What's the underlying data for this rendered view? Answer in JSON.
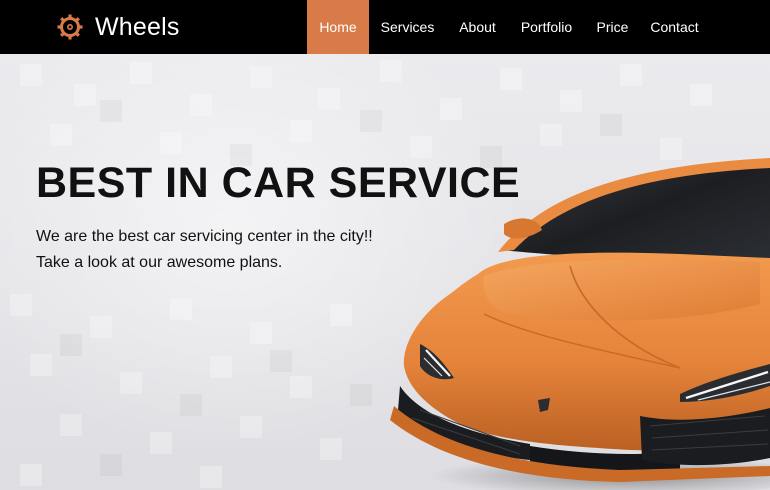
{
  "brand": {
    "name": "Wheels",
    "icon": "gear-icon",
    "accent": "#d97b48"
  },
  "nav": {
    "items": [
      {
        "label": "Home",
        "active": true
      },
      {
        "label": "Services",
        "active": false
      },
      {
        "label": "About",
        "active": false
      },
      {
        "label": "Portfolio",
        "active": false
      },
      {
        "label": "Price",
        "active": false
      },
      {
        "label": "Contact",
        "active": false
      }
    ]
  },
  "hero": {
    "title": "BEST IN CAR SERVICE",
    "line1": "We are the best car servicing center in the city!!",
    "line2": "Take a look at our awesome plans.",
    "image": "orange-sports-car"
  },
  "colors": {
    "header_bg": "#000000",
    "nav_active_bg": "#d97b48",
    "car_body": "#e8893f",
    "hero_bg": "#e6e6e9"
  }
}
